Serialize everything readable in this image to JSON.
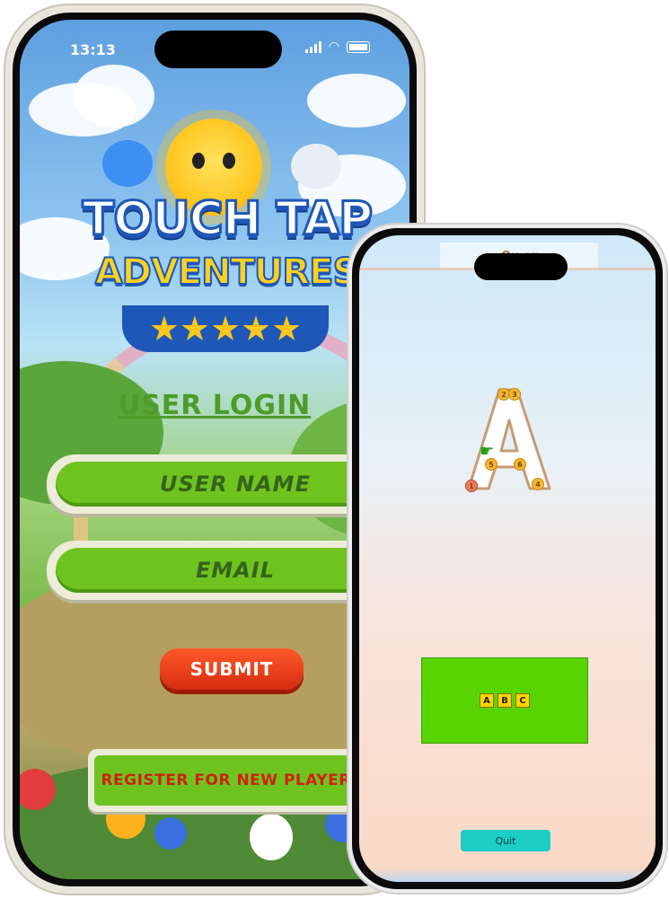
{
  "status_bar": {
    "time": "13:13"
  },
  "game_logo": {
    "title_line1": "TOUCH TAP",
    "title_line2": "ADVENTURES",
    "stars": "★★★★★"
  },
  "login": {
    "heading": "USER LOGIN",
    "username_placeholder": "USER NAME",
    "email_placeholder": "EMAIL",
    "submit_label": "SUBMIT",
    "register_label": "REGISTER FOR NEW PLAYERS"
  },
  "tracing_screen": {
    "banner_text": "Ou            er",
    "letter": "A",
    "stroke_points": [
      "1",
      "2",
      "3",
      "4",
      "5",
      "6"
    ],
    "answer_options": [
      "A",
      "B",
      "C"
    ],
    "quit_label": "Quit"
  },
  "colors": {
    "button_green": "#6fc31f",
    "submit_red": "#e3421c",
    "register_text": "#d11f12",
    "answer_panel": "#58d402",
    "quit_teal": "#1ccdc6"
  }
}
